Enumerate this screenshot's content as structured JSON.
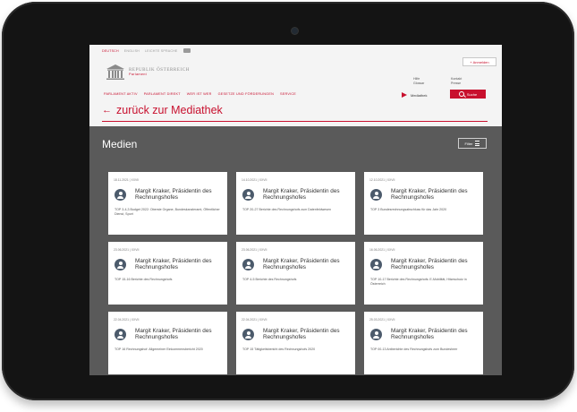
{
  "header": {
    "languages": [
      "DEUTSCH",
      "ENGLISH",
      "LEICHTE SPRACHE"
    ],
    "login_label": "+ Anmelden",
    "logo_line1": "REPUBLIK ÖSTERREICH",
    "logo_line2": "Parlament",
    "util_left": [
      "Hilfe",
      "Glossar"
    ],
    "util_right": [
      "Kontakt",
      "Presse"
    ],
    "nav": [
      "PARLAMENT AKTIV",
      "PARLAMENT DIREKT",
      "WER IST WER",
      "GESETZE UND FÖRDERUNGEN",
      "SERVICE"
    ],
    "mediathek_label": "Mediathek",
    "search_label": "Suche",
    "back_label": "zurück zur Mediathek"
  },
  "main": {
    "title": "Medien",
    "filter_label": "Filter",
    "cards": [
      {
        "meta": "18.11.2021 | XXVII",
        "title": "Margit Kraker, Präsidentin des Rechnungshofes",
        "desc": "TOP 3-4,3 Budget 2022: Oberste Organe, Bundeskanzleramt, Öffentlicher Dienst, Sport"
      },
      {
        "meta": "14.10.2021 | XXVII",
        "title": "Margit Kraker, Präsidentin des Rechnungshofes",
        "desc": "TOP 20-27 Berichte des Rechnungshofs zum Datenfeldwesen"
      },
      {
        "meta": "12.10.2021 | XXVII",
        "title": "Margit Kraker, Präsidentin des Rechnungshofes",
        "desc": "TOP 3 Bundesrechnungsabschluss für das Jahr 2020"
      },
      {
        "meta": "23.06.2021 | XXVII",
        "title": "Margit Kraker, Präsidentin des Rechnungshofes",
        "desc": "TOP 15-16 Berichte des Rechnungshofs"
      },
      {
        "meta": "23.06.2021 | XXVII",
        "title": "Margit Kraker, Präsidentin des Rechnungshofes",
        "desc": "TOP 4-5 Berichte des Rechnungshofs"
      },
      {
        "meta": "16.06.2021 | XXVII",
        "title": "Margit Kraker, Präsidentin des Rechnungshofes",
        "desc": "TOP 10-17 Berichte des Rechnungshofs: E-Mobilität, Hitzeschutz in Österreich"
      },
      {
        "meta": "22.04.2021 | XXVII",
        "title": "Margit Kraker, Präsidentin des Rechnungshofes",
        "desc": "TOP 16 Rechnungshof: Allgemeiner Einkommensbericht 2020"
      },
      {
        "meta": "22.04.2021 | XXVII",
        "title": "Margit Kraker, Präsidentin des Rechnungshofes",
        "desc": "TOP 15 Tätigkeitsbericht des Rechnungshofs 2020"
      },
      {
        "meta": "25.03.2021 | XXVII",
        "title": "Margit Kraker, Präsidentin des Rechnungshofes",
        "desc": "TOP 00-13 Antberichte des Rechnungshofs zum Bundesheer"
      }
    ]
  },
  "colors": {
    "accent": "#c8102e",
    "content_bg": "#5a5a5a",
    "header_bg": "#f4f4f4",
    "avatar": "#4b5a6b"
  }
}
